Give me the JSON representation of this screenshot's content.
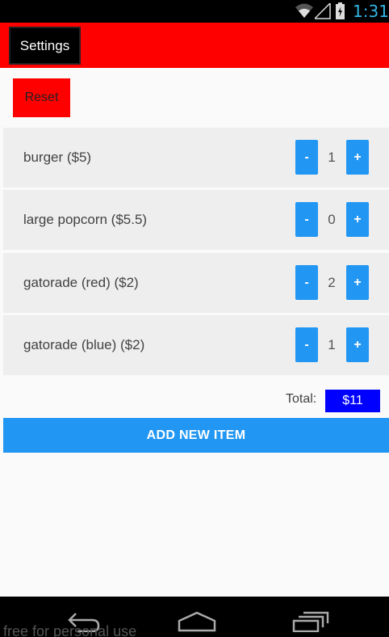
{
  "status_bar": {
    "time": "1:31",
    "icons": [
      "wifi-icon",
      "signal-icon",
      "battery-charging-icon"
    ],
    "time_color": "#33b5e5"
  },
  "app_bar": {
    "settings_label": "Settings",
    "color": "#ff0000"
  },
  "reset_label": "Reset",
  "items": [
    {
      "label": "burger ($5)",
      "quantity": "1",
      "minus": "-",
      "plus": "+"
    },
    {
      "label": "large popcorn ($5.5)",
      "quantity": "0",
      "minus": "-",
      "plus": "+"
    },
    {
      "label": "gatorade (red) ($2)",
      "quantity": "2",
      "minus": "-",
      "plus": "+"
    },
    {
      "label": "gatorade (blue) ($2)",
      "quantity": "1",
      "minus": "-",
      "plus": "+"
    }
  ],
  "total": {
    "label": "Total:",
    "value": "$11"
  },
  "add_item_label": "ADD NEW ITEM",
  "nav_bar": {
    "icons": [
      "back-icon",
      "home-icon",
      "recents-icon"
    ]
  },
  "watermark": "free for personal use",
  "colors": {
    "accent": "#2196f3",
    "total_bg": "#0000ff"
  }
}
